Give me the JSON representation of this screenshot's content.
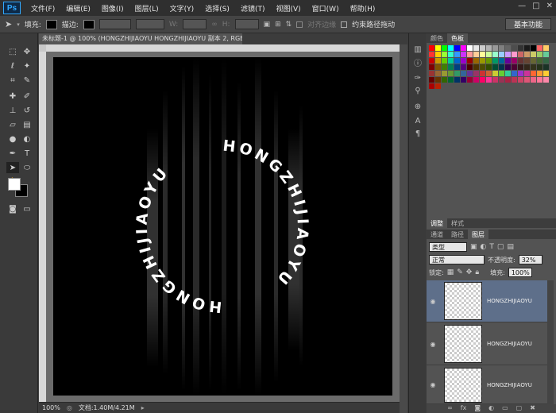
{
  "app": {
    "logo": "Ps"
  },
  "menu": [
    "文件(F)",
    "编辑(E)",
    "图像(I)",
    "图层(L)",
    "文字(Y)",
    "选择(S)",
    "滤镜(T)",
    "视图(V)",
    "窗口(W)",
    "帮助(H)"
  ],
  "window_controls": [
    "—",
    "□",
    "✕"
  ],
  "options_bar": {
    "fill_label": "填充:",
    "stroke_label": "描边:",
    "w_label": "W:",
    "h_label": "H:",
    "align_edges": "对齐边缘",
    "constrain_path": "约束路径拖动",
    "workspace": "基本功能"
  },
  "document": {
    "tab_title": "未标题-1 @ 100% (HONGZHIJIAOYU   HONGZHIJIAOYU 副本 2, RGB/8) *",
    "tab_close": "×",
    "ring_text": "HONGZHIJIAOYU"
  },
  "status": {
    "zoom": "100%",
    "doc_size": "文档:1.40M/4.21M"
  },
  "panels": {
    "color_tab": "颜色",
    "swatches_tab": "色板",
    "adjust_tab": "调整",
    "styles_tab": "样式",
    "channels_tab": "通道",
    "paths_tab": "路径",
    "layers_tab": "图层",
    "filter_kind": "类型",
    "blend_mode": "正常",
    "opacity_label": "不透明度:",
    "opacity": "32%",
    "lock_label": "锁定:",
    "fill_label": "填充:",
    "fill": "100%"
  },
  "layers": [
    {
      "name": "HONGZHIJIAOYU",
      "selected": true
    },
    {
      "name": "HONGZHIJIAOYU",
      "selected": false
    },
    {
      "name": "HONGZHIJIAOYU",
      "selected": false
    }
  ],
  "colors": {
    "accent": "#31a8ff",
    "selection": "#5e6f8a"
  }
}
